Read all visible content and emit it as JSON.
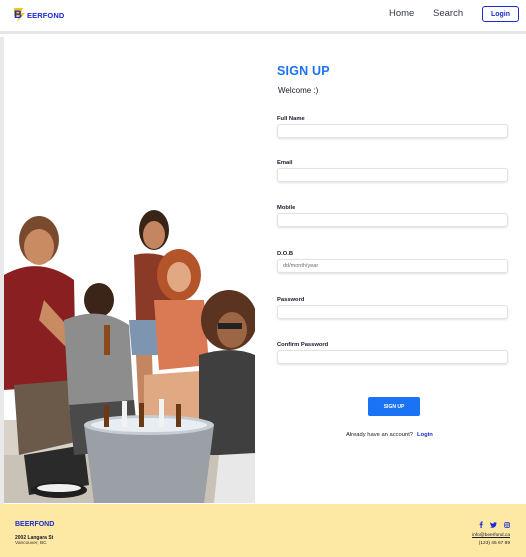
{
  "header": {
    "logo_text": "EERFOND",
    "logo_letter": "B",
    "nav": {
      "home": "Home",
      "search": "Search"
    },
    "login_label": "Login"
  },
  "form": {
    "title": "SIGN UP",
    "subtitle": "Welcome :)",
    "fields": [
      {
        "label": "Full Name",
        "value": "",
        "placeholder": ""
      },
      {
        "label": "Email",
        "value": "",
        "placeholder": ""
      },
      {
        "label": "Mobile",
        "value": "",
        "placeholder": ""
      },
      {
        "label": "D.O.B",
        "value": "",
        "placeholder": "dd/month/year"
      },
      {
        "label": "Password",
        "value": "",
        "placeholder": ""
      },
      {
        "label": "Confirm Password",
        "value": "",
        "placeholder": ""
      }
    ],
    "submit_label": "SIGN UP",
    "already_text": "Already have an account?",
    "login_link": "Login"
  },
  "footer": {
    "brand": "BEERFOND",
    "address_line1": "2002 Langara St",
    "address_line2": "Vancouver, BC",
    "email": "info@beerfond.ca",
    "phone": "(123) 45 67 89",
    "socials": [
      "facebook-icon",
      "twitter-icon",
      "instagram-icon"
    ]
  },
  "colors": {
    "brand_blue": "#1b2bd1",
    "accent_blue": "#1a73f5",
    "footer_bg": "#fde9a3",
    "logo_yellow": "#f5c518"
  }
}
